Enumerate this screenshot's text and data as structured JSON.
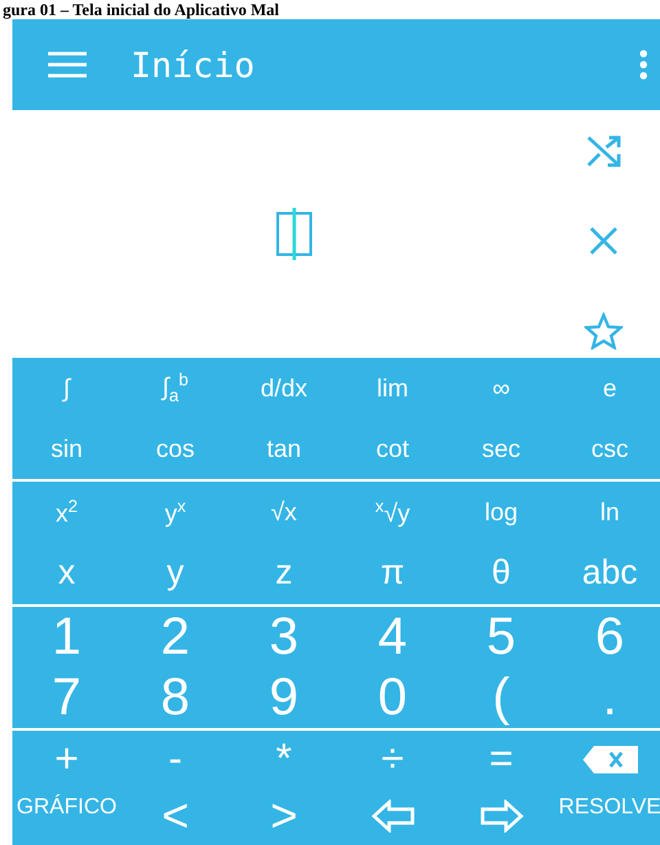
{
  "caption": "gura 01 – Tela inicial do Aplicativo Mal",
  "app_bar": {
    "title": "Início"
  },
  "keypad": {
    "sections": [
      {
        "rows": [
          {
            "kind": "function",
            "keys": [
              {
                "kind": "text",
                "label": "∫"
              },
              {
                "kind": "text",
                "label": "∫$_{a}$$^{b}$"
              },
              {
                "kind": "text",
                "label": "d/dx"
              },
              {
                "kind": "text",
                "label": "lim"
              },
              {
                "kind": "text",
                "label": "∞"
              },
              {
                "kind": "text",
                "label": "e"
              }
            ]
          },
          {
            "kind": "function",
            "keys": [
              {
                "kind": "text",
                "label": "sin"
              },
              {
                "kind": "text",
                "label": "cos"
              },
              {
                "kind": "text",
                "label": "tan"
              },
              {
                "kind": "text",
                "label": "cot"
              },
              {
                "kind": "text",
                "label": "sec"
              },
              {
                "kind": "text",
                "label": "csc"
              }
            ]
          }
        ]
      },
      {
        "rows": [
          {
            "kind": "function",
            "keys": [
              {
                "kind": "text",
                "label": "x$^{2}$"
              },
              {
                "kind": "text",
                "label": "y$^{x}$"
              },
              {
                "kind": "text",
                "label": "√x"
              },
              {
                "kind": "text",
                "label": "$^{x}$√y"
              },
              {
                "kind": "text",
                "label": "log"
              },
              {
                "kind": "text",
                "label": "ln"
              }
            ]
          },
          {
            "kind": "variable",
            "keys": [
              {
                "kind": "text",
                "label": "x"
              },
              {
                "kind": "text",
                "label": "y"
              },
              {
                "kind": "text",
                "label": "z"
              },
              {
                "kind": "text",
                "label": "π"
              },
              {
                "kind": "text",
                "label": "θ"
              },
              {
                "kind": "text",
                "label": "abc"
              }
            ]
          }
        ]
      },
      {
        "rows": [
          {
            "kind": "digit",
            "keys": [
              {
                "kind": "text",
                "label": "1"
              },
              {
                "kind": "text",
                "label": "2"
              },
              {
                "kind": "text",
                "label": "3"
              },
              {
                "kind": "text",
                "label": "4"
              },
              {
                "kind": "text",
                "label": "5"
              },
              {
                "kind": "text",
                "label": "6"
              }
            ]
          },
          {
            "kind": "digit",
            "keys": [
              {
                "kind": "text",
                "label": "7"
              },
              {
                "kind": "text",
                "label": "8"
              },
              {
                "kind": "text",
                "label": "9"
              },
              {
                "kind": "text",
                "label": "0"
              },
              {
                "kind": "text",
                "label": "("
              },
              {
                "kind": "text",
                "label": "."
              }
            ]
          }
        ]
      },
      {
        "rows": [
          {
            "kind": "operator",
            "keys": [
              {
                "kind": "text",
                "label": "+"
              },
              {
                "kind": "text",
                "label": "-"
              },
              {
                "kind": "text",
                "label": "*"
              },
              {
                "kind": "text",
                "label": "÷"
              },
              {
                "kind": "text",
                "label": "="
              },
              {
                "kind": "backspace"
              }
            ]
          },
          {
            "kind": "action",
            "keys": [
              {
                "kind": "small",
                "label": "GRÁFICO"
              },
              {
                "kind": "text",
                "label": "<"
              },
              {
                "kind": "text",
                "label": ">"
              },
              {
                "kind": "arrowleft"
              },
              {
                "kind": "arrowright"
              },
              {
                "kind": "small",
                "label": "RESOLVE"
              }
            ]
          }
        ]
      }
    ]
  }
}
